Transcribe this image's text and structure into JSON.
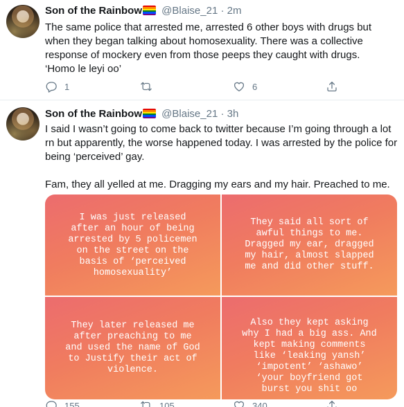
{
  "tweets": [
    {
      "name": "Son of the Rainbow",
      "handle": "@Blaise_21",
      "dot": "·",
      "time": "2m",
      "paragraphs": [
        "The same police that arrested me, arrested 6 other boys with drugs but when they began talking about homosexuality. There was a collective response of mockery even from those peeps they caught with drugs.\n‘Homo le leyi oo’"
      ],
      "actions": {
        "reply": "1",
        "retweet": "",
        "like": "6"
      }
    },
    {
      "name": "Son of the Rainbow",
      "handle": "@Blaise_21",
      "dot": "·",
      "time": "3h",
      "paragraphs": [
        "I said I wasn’t going to come back to twitter because I’m going through a lot rn but apparently, the worse happened today. I was arrested by the police for being ‘perceived’ gay.",
        "Fam, they all yelled at me. Dragging my ears and my hair. Preached to me."
      ],
      "media": [
        "I was just released\nafter an hour of being\narrested by 5 policemen\non the street on the\nbasis of ‘perceived\nhomosexuality’",
        "They said all sort of\nawful things to me.\nDragged my ear, dragged\nmy hair, almost slapped\nme and did other stuff.",
        "They later released me\nafter preaching to me\nand used the name of God\nto Justify their act of\nviolence.",
        "Also they kept asking\nwhy I had a big ass. And\nkept making comments\nlike ‘leaking yansh’\n‘impotent’ ‘ashawo’\n‘your boyfriend got\nburst you shit oo"
      ],
      "actions": {
        "reply": "155",
        "retweet": "105",
        "like": "340"
      }
    }
  ],
  "colors": {
    "accent_text": "#14171a",
    "muted": "#657786",
    "divider": "#e6ecf0",
    "panel_gradient": [
      "#ec6c6e",
      "#f59a5b"
    ],
    "pride_flag": [
      "#e40303",
      "#ff8c00",
      "#ffed00",
      "#008026",
      "#004dff",
      "#750787"
    ]
  },
  "icons": [
    "reply-icon",
    "retweet-icon",
    "like-icon",
    "share-icon",
    "rainbow-flag-icon"
  ]
}
